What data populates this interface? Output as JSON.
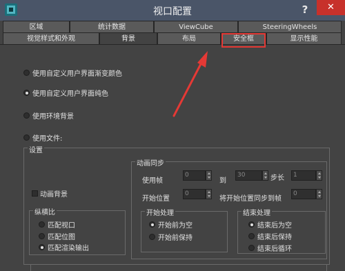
{
  "window": {
    "title": "视口配置",
    "help": "?",
    "close": "✕"
  },
  "tabs_row1": [
    "区域",
    "统计数据",
    "ViewCube",
    "SteeringWheels"
  ],
  "tabs_row2": [
    "视觉样式和外观",
    "背景",
    "布局",
    "安全框",
    "显示性能"
  ],
  "active_tab": "背景",
  "highlighted_tab": "安全框",
  "background_options": [
    {
      "label": "使用自定义用户界面渐变颜色",
      "selected": false
    },
    {
      "label": "使用自定义用户界面纯色",
      "selected": true
    },
    {
      "label": "使用环境背景",
      "selected": false
    },
    {
      "label": "使用文件:",
      "selected": false
    }
  ],
  "settings": {
    "title": "设置",
    "animate_bg_label": "动画背景",
    "animate_bg_checked": false,
    "aspect": {
      "title": "纵横比",
      "options": [
        {
          "label": "匹配视口",
          "selected": false
        },
        {
          "label": "匹配位图",
          "selected": false
        },
        {
          "label": "匹配渲染输出",
          "selected": true
        }
      ]
    },
    "anim_sync": {
      "title": "动画同步",
      "use_frame_label": "使用帧",
      "use_frame_value": "0",
      "to_label": "到",
      "to_value": "30",
      "step_label": "步长",
      "step_value": "1",
      "start_label": "开始位置",
      "start_value": "0",
      "sync_label": "将开始位置同步到帧",
      "sync_value": "0"
    },
    "start_proc": {
      "title": "开始处理",
      "options": [
        {
          "label": "开始前为空",
          "selected": true
        },
        {
          "label": "开始前保持",
          "selected": false
        }
      ]
    },
    "end_proc": {
      "title": "结束处理",
      "options": [
        {
          "label": "结束后为空",
          "selected": true
        },
        {
          "label": "结束后保持",
          "selected": false
        },
        {
          "label": "结束后循环",
          "selected": false
        }
      ]
    }
  },
  "colors": {
    "annotation": "#e53935"
  }
}
